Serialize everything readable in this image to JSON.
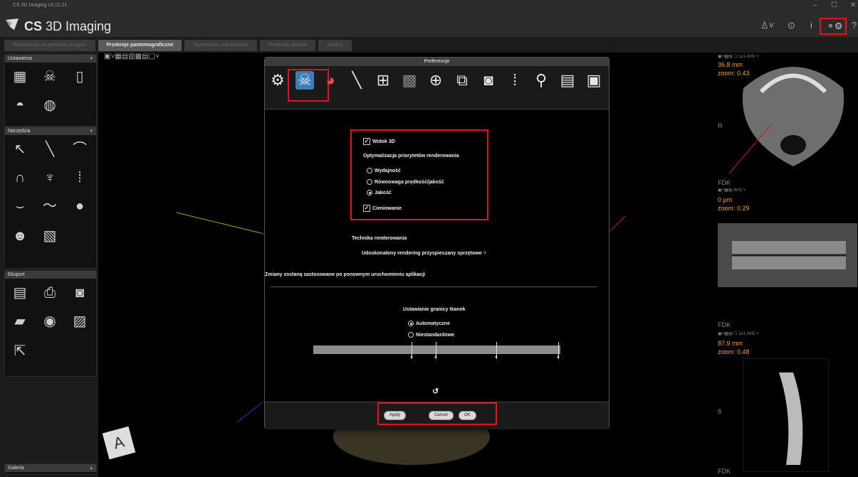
{
  "app": {
    "small_title": "CS 3D Imaging v3.10.21",
    "name_bold": "CS",
    "name_rest": " 3D Imaging"
  },
  "tabs": [
    {
      "label": "Rozdmiania na warstwie ortogon."
    },
    {
      "label": "Przekroje pantomograficzne"
    },
    {
      "label": "Stosowanie standardowe"
    },
    {
      "label": "Przekroje skośne"
    },
    {
      "label": "Analizy"
    }
  ],
  "panels": {
    "settings": "Ustawienia",
    "tools": "Narzędzia",
    "export": "Eksport",
    "gallery": "Galeria"
  },
  "right_views": {
    "view1": {
      "value": "36.8 mm",
      "zoom": "zoom: 0.43",
      "label": "R"
    },
    "view2": {
      "label": "FDK",
      "value": "0 µm",
      "zoom": "zoom: 0.29"
    },
    "view3": {
      "label": "FDK",
      "value": "87.9 mm",
      "zoom": "zoom: 0.48",
      "marker": "8"
    },
    "view4": {
      "label": "FDK"
    },
    "toolbar_text": "AVG"
  },
  "dialog": {
    "title": "Preferencje",
    "view3d": "Widok 3D",
    "optimization_label": "Optymalizacja priorytetów renderowania",
    "options": [
      {
        "label": "Wydajność",
        "selected": false
      },
      {
        "label": "Równowaga prędkość/jakość",
        "selected": false
      },
      {
        "label": "Jakość",
        "selected": true
      }
    ],
    "shading": "Cieniowanie",
    "technique_label": "Technika renderowania",
    "technique_value": "Udoskonalony rendering przyspieszany sprzętowo",
    "restart_note": "Zmiany zostaną zastosowane po ponownym uruchomieniu aplikacji",
    "tissue_label": "Ustawianie granicy tkanek",
    "tissue_options": [
      {
        "label": "Automatyczne",
        "selected": true
      },
      {
        "label": "Niestandardowe",
        "selected": false
      }
    ],
    "reset_icon": "↺",
    "buttons": {
      "apply": "Apply",
      "cancel": "Cancel",
      "ok": "OK"
    }
  },
  "accent_red": "#e0141e",
  "accent_orange": "#f0a020"
}
